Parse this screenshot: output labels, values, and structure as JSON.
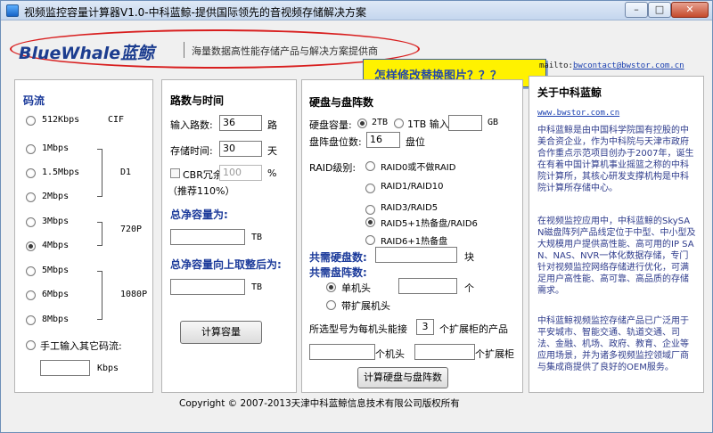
{
  "window": {
    "title": "视频监控容量计算器V1.0-中科蓝鲸-提供国际领先的音视频存储解决方案",
    "btn_min": "–",
    "btn_max": "□",
    "btn_close": "✕"
  },
  "logo": {
    "brand": "BlueWhale蓝鲸",
    "slogan": "海量数据高性能存储产品与解决方案提供商"
  },
  "annotation": {
    "text": "怎样修改替换图片？？？"
  },
  "contact": {
    "prefix": "mailto:",
    "email": "bwcontact@bwstor.com.cn"
  },
  "bitrate": {
    "heading": "码流",
    "options": [
      {
        "label": "512Kbps",
        "checked": false
      },
      {
        "label": "1Mbps",
        "checked": false
      },
      {
        "label": "1.5Mbps",
        "checked": false
      },
      {
        "label": "2Mbps",
        "checked": false
      },
      {
        "label": "3Mbps",
        "checked": false
      },
      {
        "label": "4Mbps",
        "checked": true
      },
      {
        "label": "5Mbps",
        "checked": false
      },
      {
        "label": "6Mbps",
        "checked": false
      },
      {
        "label": "8Mbps",
        "checked": false
      }
    ],
    "res_cif": "CIF",
    "res_d1": "D1",
    "res_720p": "720P",
    "res_1080p": "1080P",
    "custom_label": "手工输入其它码流:",
    "custom_value": "",
    "unit": "Kbps"
  },
  "channels": {
    "heading": "路数与时间",
    "input_label": "输入路数:",
    "input_value": "36",
    "input_unit": "路",
    "days_label": "存储时间:",
    "days_value": "30",
    "days_unit": "天",
    "cbr_label": "CBR冗余",
    "cbr_value": "100",
    "cbr_unit": "%",
    "cbr_hint": "（推荐110%）",
    "total_heading": "总净容量为:",
    "total_value": "",
    "total_unit": "TB",
    "round_heading": "总净容量向上取整后为:",
    "round_value": "",
    "round_unit": "TB",
    "calc_button": "计算容量"
  },
  "disks": {
    "heading": "硬盘与盘阵数",
    "capacity_label": "硬盘容量:",
    "opt_2tb": "2TB",
    "opt_1tb": "1TB 输入:",
    "capacity_input": "",
    "capacity_unit": "GB",
    "slots_label": "盘阵盘位数:",
    "slots_value": "16",
    "slots_unit": "盘位",
    "raid_label": "RAID级别:",
    "raid_options": [
      {
        "label": "RAID0或不做RAID",
        "checked": false
      },
      {
        "label": "RAID1/RAID10",
        "checked": false
      },
      {
        "label": "RAID3/RAID5",
        "checked": false
      },
      {
        "label": "RAID5+1热备盘/RAID6",
        "checked": true
      },
      {
        "label": "RAID6+1热备盘",
        "checked": false
      }
    ],
    "need_disks_label": "共需硬盘数:",
    "need_disks_value": "",
    "need_disks_unit": "块",
    "need_arrays_label": "共需盘阵数:",
    "opt_single": "单机头",
    "single_value": "",
    "single_unit": "个",
    "opt_expansion": "带扩展机头",
    "model_label": "所选型号为每机头能接",
    "model_value": "3",
    "model_suffix": "个扩展柜的产品",
    "heads_value": "",
    "heads_unit": "个机头",
    "cab_value": "",
    "cab_unit": "个扩展柜",
    "calc_button": "计算硬盘与盘阵数"
  },
  "about": {
    "heading": "关于中科蓝鲸",
    "website": "www.bwstor.com.cn",
    "para1": "中科蓝鲸是由中国科学院国有控股的中美合资企业，作为中科院与天津市政府合作重点示范项目创办于2007年，诞生在有着中国计算机事业摇篮之称的中科院计算所，其核心研发支撑机构是中科院计算所存储中心。",
    "para2": "在视频监控应用中，中科蓝鲸的SkySAN磁盘阵列产品线定位于中型、中小型及大规模用户提供高性能、高可用的IP SAN、NAS、NVR一体化数据存储，专门针对视频监控网络存储进行优化，可满足用户高性能、高可靠、高品质的存储需求。",
    "para3": "中科蓝鲸视频监控存储产品已广泛用于平安城市、智能交通、轨道交通、司法、金融、机场、政府、教育、企业等应用场景，并为诸多视频监控领域厂商与集成商提供了良好的OEM服务。"
  },
  "footer": {
    "copyright": "Copyright © 2007-2013天津中科蓝鲸信息技术有限公司版权所有"
  },
  "colors": {
    "annotation_bg": "#fff200",
    "circle": "#d81e1e",
    "brand_blue": "#1c3d8f",
    "about_text": "#2f3c8c"
  }
}
